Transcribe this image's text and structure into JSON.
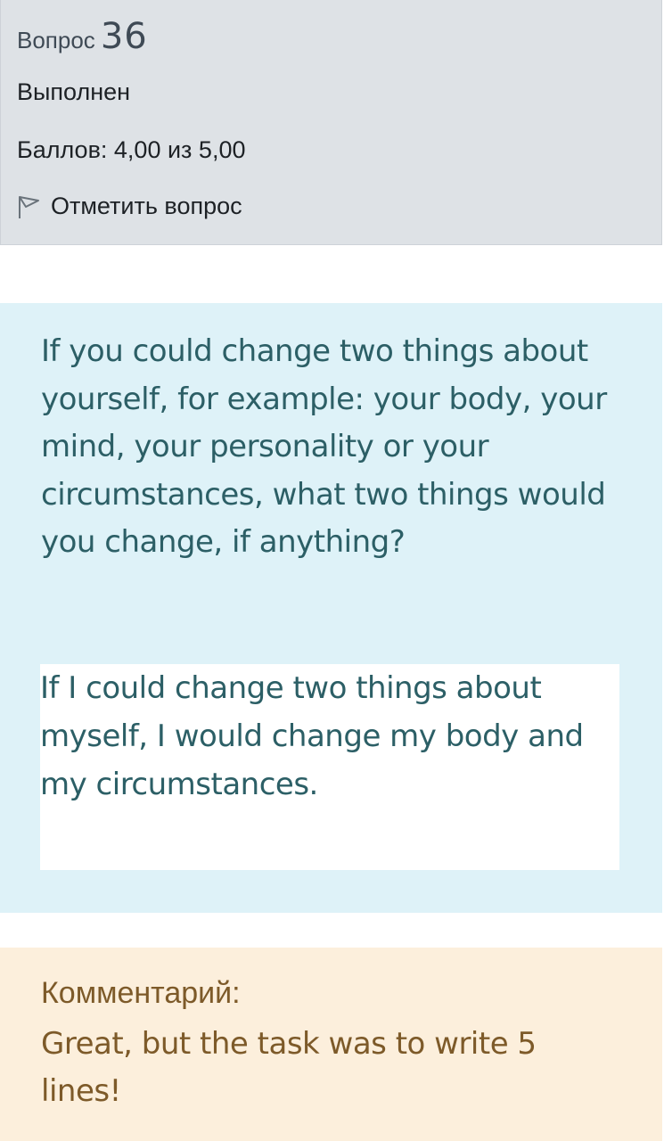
{
  "info": {
    "question_prefix": "Вопрос",
    "question_number": "36",
    "state": "Выполнен",
    "grade": "Баллов: 4,00 из 5,00",
    "flag_label": "Отметить вопрос",
    "flag_icon": "flag-outline-icon"
  },
  "question": {
    "text": "If you could change two things about yourself, for example: your body, your mind, your personality or your circumstances, what two things would you change, if anything?",
    "answer": "If I could change two things about myself, I would change my body and my circumstances."
  },
  "feedback": {
    "label": "Комментарий:",
    "text": "Great, but the task was to write 5 lines!"
  },
  "colors": {
    "info_bg": "#dee2e6",
    "question_bg": "#def2f8",
    "question_text": "#2c5f66",
    "comment_bg": "#fcefdc",
    "comment_text": "#7d5a29"
  }
}
